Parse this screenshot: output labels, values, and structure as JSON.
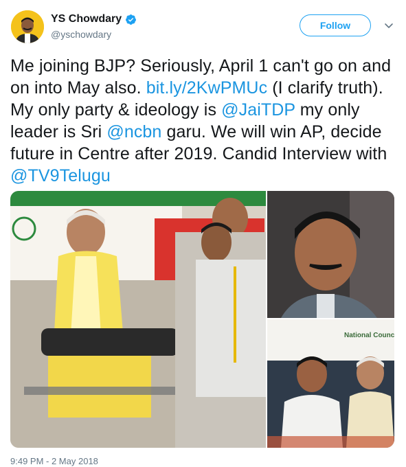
{
  "user": {
    "display_name": "YS Chowdary",
    "handle": "@yschowdary",
    "verified_icon": "verified-badge-icon",
    "avatar_color": "#f4c21b"
  },
  "actions": {
    "follow_label": "Follow",
    "more_icon": "chevron-down-icon"
  },
  "tweet": {
    "segments": [
      {
        "type": "text",
        "text": "Me joining BJP? Seriously, April 1 can't go on and on into May also. "
      },
      {
        "type": "link",
        "text": "bit.ly/2KwPMUc"
      },
      {
        "type": "text",
        "text": " (I clarify truth). My only party & ideology is "
      },
      {
        "type": "link",
        "text": "@JaiTDP"
      },
      {
        "type": "text",
        "text": "  my only leader is Sri "
      },
      {
        "type": "link",
        "text": "@ncbn"
      },
      {
        "type": "text",
        "text": " garu. We will win AP, decide future in Centre after 2019. Candid Interview with "
      },
      {
        "type": "link",
        "text": "@TV9Telugu"
      }
    ],
    "link_color": "#1b95e0"
  },
  "media": {
    "photo3_banner": "National Council for"
  },
  "timestamp": "9:49 PM - 2 May 2018"
}
